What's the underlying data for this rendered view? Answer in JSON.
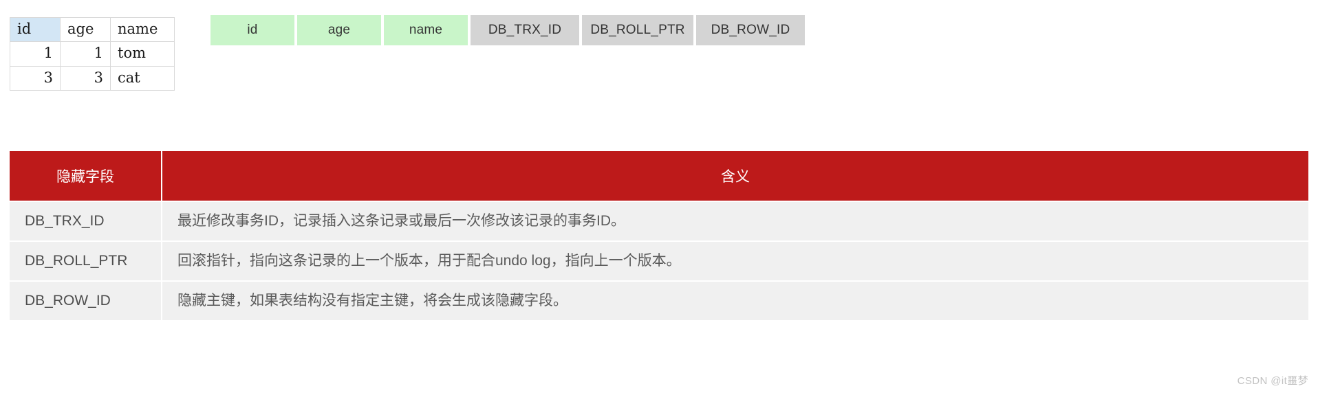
{
  "record_table": {
    "headers": [
      "id",
      "age",
      "name"
    ],
    "key_column_index": 0,
    "rows": [
      {
        "id": "1",
        "age": "1",
        "name": "tom"
      },
      {
        "id": "3",
        "age": "3",
        "name": "cat"
      }
    ]
  },
  "field_strip": {
    "user_columns": [
      "id",
      "age",
      "name"
    ],
    "hidden_columns": [
      "DB_TRX_ID",
      "DB_ROLL_PTR",
      "DB_ROW_ID"
    ],
    "user_color": "#c9f5c9",
    "hidden_color": "#d4d4d4"
  },
  "meaning_table": {
    "header_color": "#bd1a1a",
    "row_color": "#f0f0f0",
    "headers": {
      "field": "隐藏字段",
      "meaning": "含义"
    },
    "rows": [
      {
        "field": "DB_TRX_ID",
        "meaning": "最近修改事务ID，记录插入这条记录或最后一次修改该记录的事务ID。"
      },
      {
        "field": "DB_ROLL_PTR",
        "meaning": "回滚指针，指向这条记录的上一个版本，用于配合undo log，指向上一个版本。"
      },
      {
        "field": "DB_ROW_ID",
        "meaning": "隐藏主键，如果表结构没有指定主键，将会生成该隐藏字段。"
      }
    ]
  },
  "watermark": {
    "text": "CSDN @it噩梦"
  }
}
